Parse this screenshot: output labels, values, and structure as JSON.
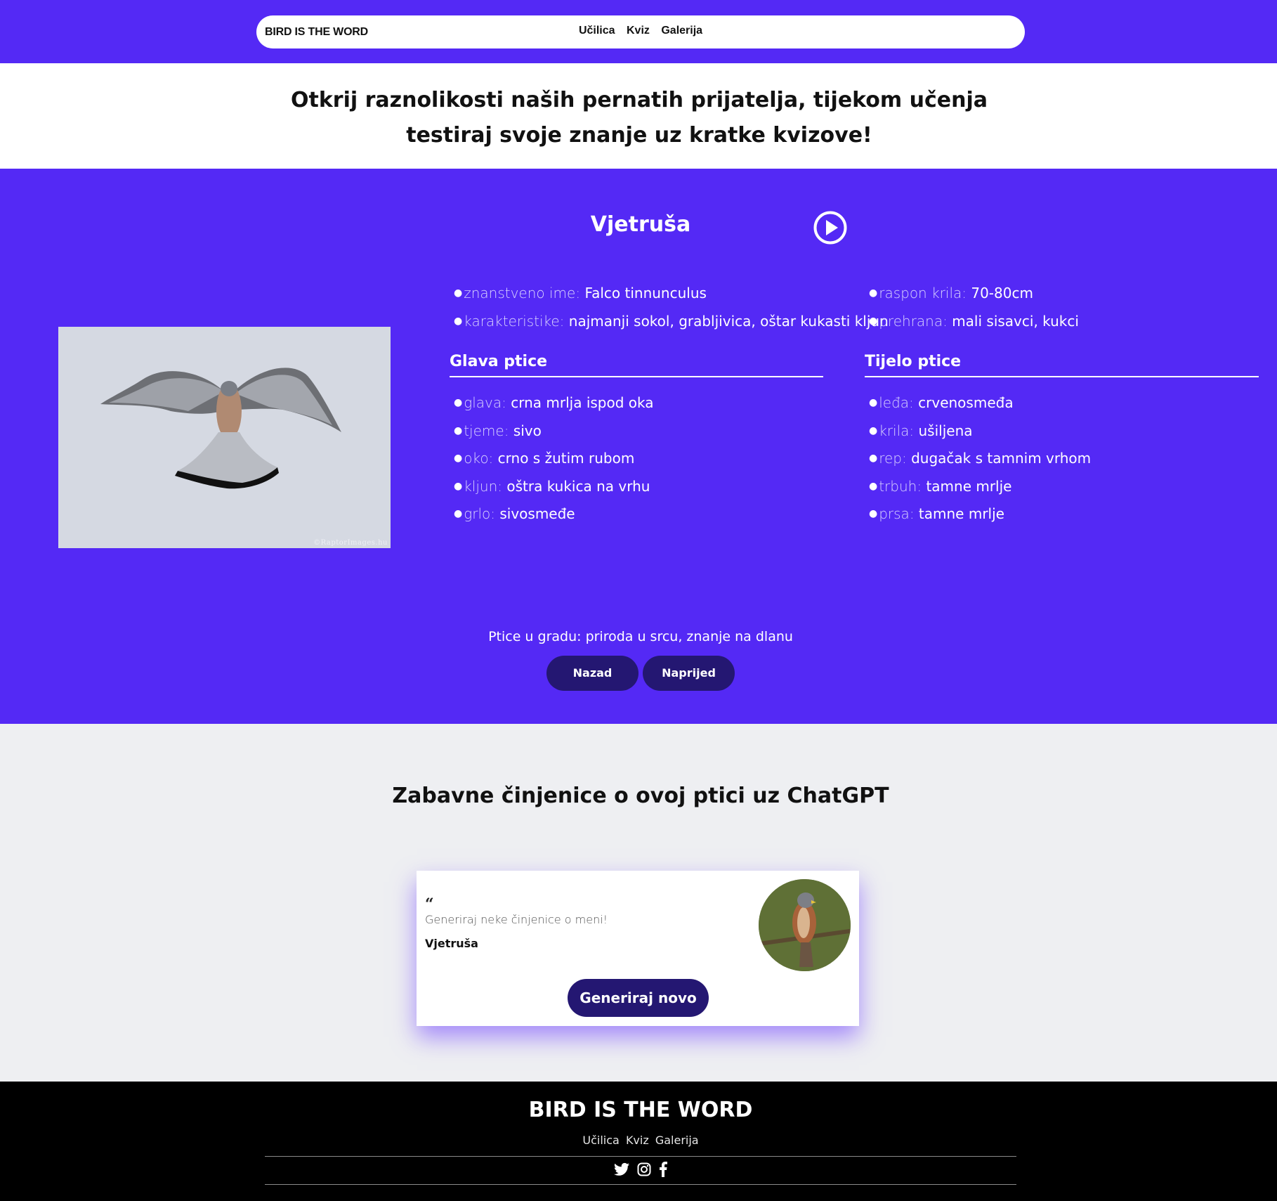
{
  "nav": {
    "brand": "BIRD IS THE WORD",
    "links": [
      "Učilica",
      "Kviz",
      "Galerija"
    ]
  },
  "hero": {
    "headline": "Otkrij raznolikosti naših pernatih prijatelja, tijekom učenja testiraj svoje znanje uz kratke kvizove!"
  },
  "bird": {
    "name": "Vjetruša",
    "photo_credit": "©RaptorImages.hu",
    "general_left": [
      {
        "key": "znanstveno ime:",
        "value": "Falco tinnunculus"
      },
      {
        "key": "karakteristike:",
        "value": "najmanji sokol, grabljivica, oštar kukasti kljun"
      }
    ],
    "general_right": [
      {
        "key": "raspon krila:",
        "value": "70-80cm"
      },
      {
        "key": "prehrana:",
        "value": "mali sisavci, kukci"
      }
    ],
    "head_title": "Glava ptice",
    "head": [
      {
        "key": "glava:",
        "value": "crna mrlja ispod oka"
      },
      {
        "key": "tjeme:",
        "value": "sivo"
      },
      {
        "key": "oko:",
        "value": "crno s žutim rubom"
      },
      {
        "key": "kljun:",
        "value": "oštra kukica na vrhu"
      },
      {
        "key": "grlo:",
        "value": "sivosmeđe"
      }
    ],
    "body_title": "Tijelo ptice",
    "body": [
      {
        "key": "leđa:",
        "value": "crvenosmeđa"
      },
      {
        "key": "krila:",
        "value": "ušiljena"
      },
      {
        "key": "rep:",
        "value": "dugačak s tamnim vrhom"
      },
      {
        "key": "trbuh:",
        "value": "tamne mrlje"
      },
      {
        "key": "prsa:",
        "value": "tamne mrlje"
      }
    ],
    "tagline": "Ptice u gradu: priroda u srcu, znanje na dlanu",
    "back_label": "Nazad",
    "next_label": "Naprijed"
  },
  "facts": {
    "title": "Zabavne činjenice o ovoj ptici uz ChatGPT",
    "quote_mark": "“",
    "text": "Generiraj neke činjenice o meni!",
    "name": "Vjetruša",
    "button_label": "Generiraj novo"
  },
  "footer": {
    "brand": "BIRD IS THE WORD",
    "links": [
      "Učilica",
      "Kviz",
      "Galerija"
    ],
    "socials": [
      "twitter-icon",
      "instagram-icon",
      "facebook-icon"
    ]
  },
  "colors": {
    "primary": "#5429f5",
    "button_dark": "#241772",
    "facts_bg": "#eeeff2",
    "footer_bg": "#000000"
  }
}
